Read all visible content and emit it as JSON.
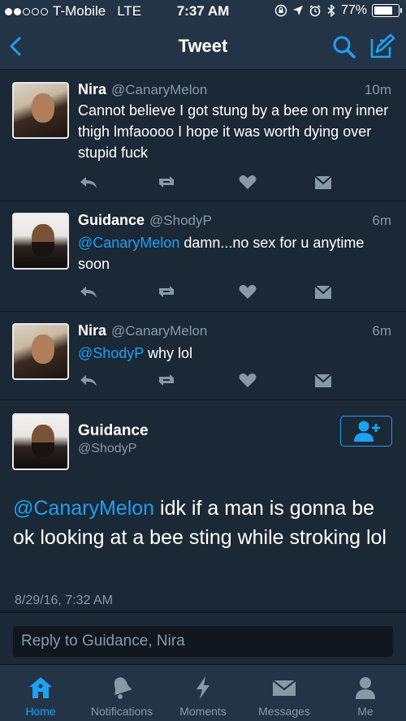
{
  "status_bar": {
    "carrier": "T-Mobile",
    "network": "LTE",
    "time": "7:37 AM",
    "battery": "77%",
    "battery_level": 0.77,
    "icons": [
      "signal-dots-icon",
      "lock-rotation-icon",
      "location-icon",
      "alarm-icon",
      "bluetooth-icon",
      "battery-icon"
    ]
  },
  "navbar": {
    "title": "Tweet",
    "icons": [
      "back-icon",
      "search-icon",
      "compose-icon"
    ]
  },
  "tweets": [
    {
      "name": "Nira",
      "handle": "@CanaryMelon",
      "ago": "10m",
      "text": "Cannot believe I got stung by a bee on my inner thigh lmfaoooo I hope it was worth dying over stupid fuck",
      "mention": ""
    },
    {
      "name": "Guidance",
      "handle": "@ShodyP",
      "ago": "6m",
      "mention": "@CanaryMelon",
      "text": " damn...no sex for u anytime soon"
    },
    {
      "name": "Nira",
      "handle": "@CanaryMelon",
      "ago": "6m",
      "mention": "@ShodyP",
      "text": " why lol"
    }
  ],
  "detail": {
    "name": "Guidance",
    "handle": "@ShodyP",
    "mention": "@CanaryMelon",
    "text": " idk if a man is gonna be ok looking at a bee sting while stroking lol",
    "date": "8/29/16, 7:32 AM"
  },
  "reply": {
    "placeholder": "Reply to Guidance, Nira"
  },
  "tabs": [
    {
      "label": "Home",
      "icon": "home-icon",
      "active": true
    },
    {
      "label": "Notifications",
      "icon": "bell-icon",
      "active": false
    },
    {
      "label": "Moments",
      "icon": "lightning-icon",
      "active": false
    },
    {
      "label": "Messages",
      "icon": "envelope-icon",
      "active": false
    },
    {
      "label": "Me",
      "icon": "person-icon",
      "active": false
    }
  ],
  "colors": {
    "background": "#1b2836",
    "bar": "#243447",
    "accent": "#1da1f2",
    "muted": "#8899a6"
  }
}
